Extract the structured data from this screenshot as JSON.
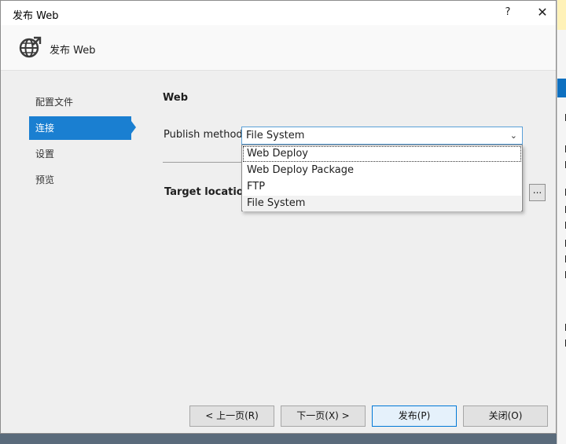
{
  "window": {
    "title": "发布 Web",
    "help": "?",
    "close": "✕"
  },
  "header": {
    "title": "发布 Web"
  },
  "nav": {
    "items": [
      {
        "label": "配置文件"
      },
      {
        "label": "连接"
      },
      {
        "label": "设置"
      },
      {
        "label": "预览"
      }
    ],
    "active_index": 1
  },
  "main": {
    "section_title": "Web",
    "publish_method_label": "Publish method:",
    "publish_method_value": "File System",
    "dropdown_options": [
      "Web Deploy",
      "Web Deploy Package",
      "FTP",
      "File System"
    ],
    "target_location_label": "Target location:",
    "browse_label": "..."
  },
  "footer": {
    "prev": "< 上一页(R)",
    "next": "下一页(X) >",
    "publish": "发布(P)",
    "close": "关闭(O)"
  },
  "colors": {
    "accent": "#1a7fd1",
    "dialog_bg": "#efefef",
    "primary_border": "#0078d7"
  },
  "icons": {
    "header": "globe-icon",
    "dropdown": "chevron-down-icon"
  }
}
